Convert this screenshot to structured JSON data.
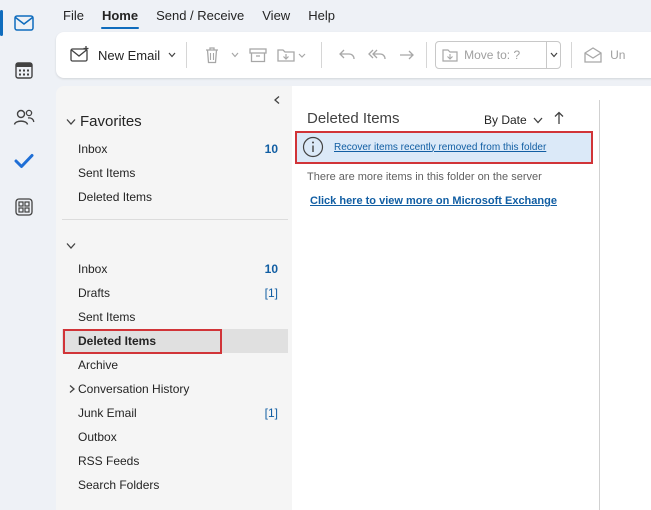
{
  "ribbon": {
    "tabs": [
      {
        "label": "File"
      },
      {
        "label": "Home"
      },
      {
        "label": "Send / Receive"
      },
      {
        "label": "View"
      },
      {
        "label": "Help"
      }
    ],
    "active_tab": "Home"
  },
  "toolbar": {
    "new_email_label": "New Email",
    "move_to_placeholder": "Move to: ?",
    "unread_label": "Un"
  },
  "folders": {
    "favorites_label": "Favorites",
    "favorites": [
      {
        "label": "Inbox",
        "count": "10"
      },
      {
        "label": "Sent Items",
        "count": ""
      },
      {
        "label": "Deleted Items",
        "count": ""
      }
    ],
    "account": [
      {
        "label": "Inbox",
        "count": "10"
      },
      {
        "label": "Drafts",
        "count": "[1]"
      },
      {
        "label": "Sent Items",
        "count": ""
      },
      {
        "label": "Deleted Items",
        "count": ""
      },
      {
        "label": "Archive",
        "count": ""
      },
      {
        "label": "Conversation History",
        "count": ""
      },
      {
        "label": "Junk Email",
        "count": "[1]"
      },
      {
        "label": "Outbox",
        "count": ""
      },
      {
        "label": "RSS Feeds",
        "count": ""
      },
      {
        "label": "Search Folders",
        "count": ""
      }
    ],
    "selected": "Deleted Items"
  },
  "message_list": {
    "title": "Deleted Items",
    "sort_label": "By Date",
    "recover_link": "Recover items recently removed from this folder",
    "more_items_text": "There are more items in this folder on the server",
    "exchange_link": "Click here to view more on Microsoft Exchange"
  },
  "colors": {
    "accent": "#0f6cbd",
    "link": "#115ea3",
    "highlight_border": "#d13438",
    "info_bar": "#dbe9f8"
  }
}
